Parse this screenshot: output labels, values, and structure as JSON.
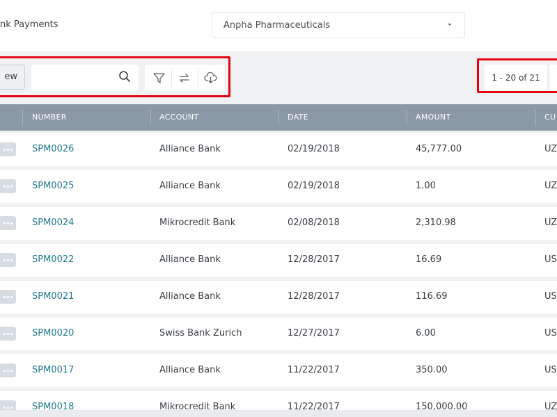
{
  "header": {
    "page_title": "ank Payments",
    "company_select_value": "Anpha Pharmaceuticals"
  },
  "toolbar": {
    "new_label": "ew",
    "search_placeholder": "",
    "pagination_label": "1 - 20 of 21"
  },
  "icons": {
    "search": "search-icon",
    "filter": "filter-icon",
    "swap": "swap-icon",
    "download": "cloud-download-icon",
    "chevron": "chevron-down-icon",
    "more": "more-dots-icon"
  },
  "colors": {
    "highlight": "#e4000f",
    "table_header": "#8b98a5",
    "link": "#1f7a8c"
  },
  "table": {
    "columns": [
      "NUMBER",
      "ACCOUNT",
      "DATE",
      "AMOUNT",
      "CU"
    ],
    "rows": [
      {
        "number": "SPM0026",
        "account": "Alliance Bank",
        "date": "02/19/2018",
        "amount": "45,777.00",
        "currency": "UZ"
      },
      {
        "number": "SPM0025",
        "account": "Alliance Bank",
        "date": "02/19/2018",
        "amount": "1.00",
        "currency": "UZ"
      },
      {
        "number": "SPM0024",
        "account": "Mikrocredit Bank",
        "date": "02/08/2018",
        "amount": "2,310.98",
        "currency": "UZ"
      },
      {
        "number": "SPM0022",
        "account": "Alliance Bank",
        "date": "12/28/2017",
        "amount": "16.69",
        "currency": "US"
      },
      {
        "number": "SPM0021",
        "account": "Alliance Bank",
        "date": "12/28/2017",
        "amount": "116.69",
        "currency": "US"
      },
      {
        "number": "SPM0020",
        "account": "Swiss Bank Zurich",
        "date": "12/27/2017",
        "amount": "6.00",
        "currency": "US"
      },
      {
        "number": "SPM0017",
        "account": "Alliance Bank",
        "date": "11/22/2017",
        "amount": "350.00",
        "currency": "US"
      },
      {
        "number": "SPM0018",
        "account": "Mikrocredit Bank",
        "date": "11/22/2017",
        "amount": "150,000.00",
        "currency": "UZ"
      }
    ]
  }
}
